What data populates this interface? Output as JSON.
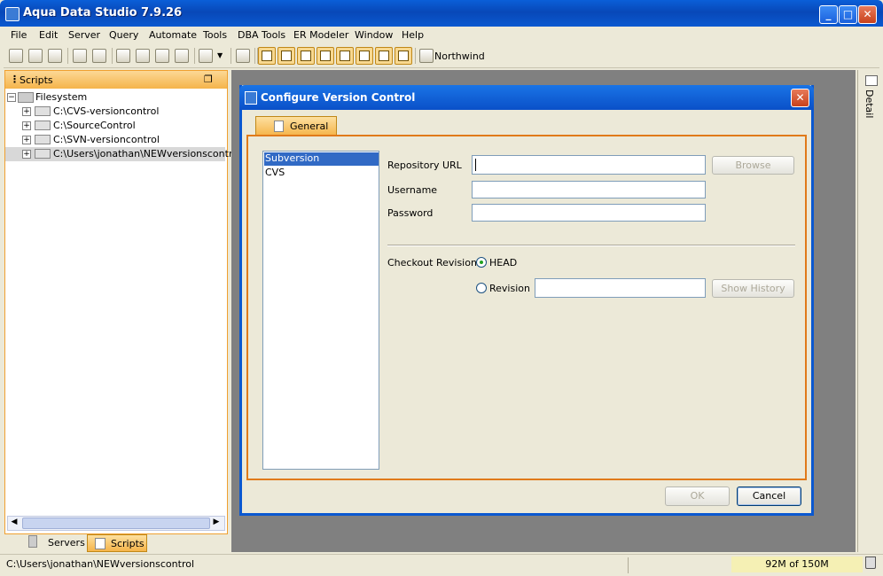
{
  "window": {
    "title": "Aqua Data Studio 7.9.26"
  },
  "menu": [
    "File",
    "Edit",
    "Server",
    "Query",
    "Automate",
    "Tools",
    "DBA Tools",
    "ER Modeler",
    "Window",
    "Help"
  ],
  "toolbar": {
    "server_label": "Northwind"
  },
  "left_panel": {
    "title": "Scripts",
    "root": "Filesystem",
    "items": [
      "C:\\CVS-versioncontrol",
      "C:\\SourceControl",
      "C:\\SVN-versioncontrol",
      "C:\\Users\\jonathan\\NEWversionscontrol"
    ]
  },
  "bottom_tabs": [
    "Servers",
    "Scripts"
  ],
  "right_strip": {
    "label": "Detail"
  },
  "dialog": {
    "title": "Configure Version Control",
    "tab": "General",
    "providers": [
      "Subversion",
      "CVS"
    ],
    "repository_url_label": "Repository URL",
    "repository_url_value": "",
    "browse_label": "Browse",
    "username_label": "Username",
    "username_value": "",
    "password_label": "Password",
    "password_value": "",
    "checkout_label": "Checkout Revision",
    "head_label": "HEAD",
    "revision_label": "Revision",
    "revision_value": "",
    "show_history_label": "Show History",
    "ok_label": "OK",
    "cancel_label": "Cancel"
  },
  "status": {
    "path": "C:\\Users\\jonathan\\NEWversionscontrol",
    "memory": "92M of 150M"
  }
}
